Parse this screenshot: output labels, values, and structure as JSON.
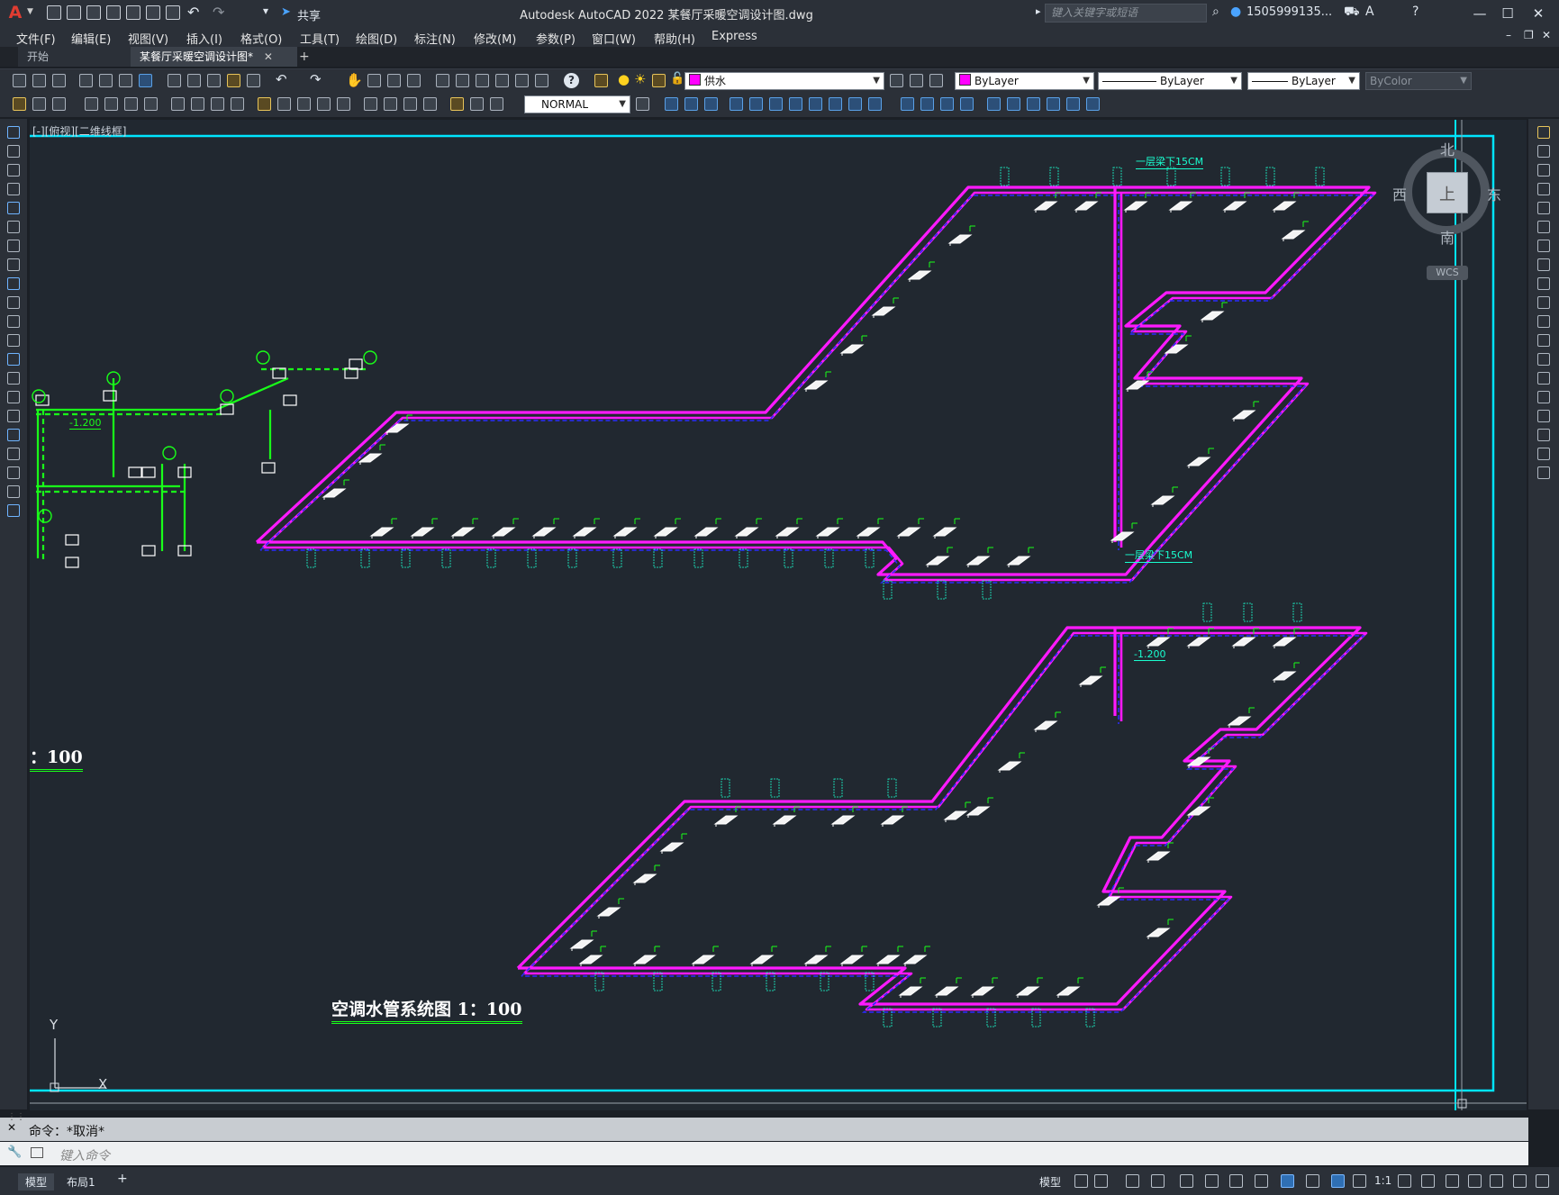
{
  "app": {
    "logo": "A",
    "share_label": "共享",
    "window_title": "Autodesk AutoCAD 2022    某餐厅采暖空调设计图.dwg",
    "search_placeholder": "键入关键字或短语",
    "user_name": "1505999135...",
    "win_min": "—",
    "win_max": "☐",
    "win_close": "✕"
  },
  "menubar": [
    {
      "label": "文件(F)"
    },
    {
      "label": "编辑(E)"
    },
    {
      "label": "视图(V)"
    },
    {
      "label": "插入(I)"
    },
    {
      "label": "格式(O)"
    },
    {
      "label": "工具(T)"
    },
    {
      "label": "绘图(D)"
    },
    {
      "label": "标注(N)"
    },
    {
      "label": "修改(M)"
    },
    {
      "label": "参数(P)"
    },
    {
      "label": "窗口(W)"
    },
    {
      "label": "帮助(H)"
    },
    {
      "label": "Express"
    }
  ],
  "tabs": {
    "start": "开始",
    "drawing": "某餐厅采暖空调设计图*",
    "close": "✕",
    "new": "+"
  },
  "toolbar": {
    "layer_name": "供水",
    "color": "ByLayer",
    "linetype": "ByLayer",
    "lineweight": "ByLayer",
    "plotstyle": "ByColor",
    "textstyle": "NORMAL"
  },
  "viewport": {
    "label": "[-][俯视][二维线框]",
    "title_main": "空调水管系统图  1：100",
    "title_partial": "：100",
    "note_top": "一层梁下15CM",
    "note_mid": "一层梁下15CM",
    "elev_mid": "-1.200",
    "elev_left": "-1.200"
  },
  "viewcube": {
    "north": "北",
    "south": "南",
    "east": "东",
    "west": "西",
    "top": "上",
    "wcs": "WCS"
  },
  "ucs": {
    "x": "X",
    "y": "Y"
  },
  "command": {
    "history": "命令：*取消*",
    "placeholder": "键入命令"
  },
  "statusbar": {
    "model_tab": "模型",
    "layout_tab": "布局1",
    "add": "+",
    "model_btn": "模型",
    "scale": "1:1"
  },
  "colors": {
    "pipe": "#ff19ff",
    "pipe_dash": "#2a2aff",
    "green_pipe": "#19ff19",
    "frame": "#00e5ff",
    "label": "#19ffd0"
  }
}
